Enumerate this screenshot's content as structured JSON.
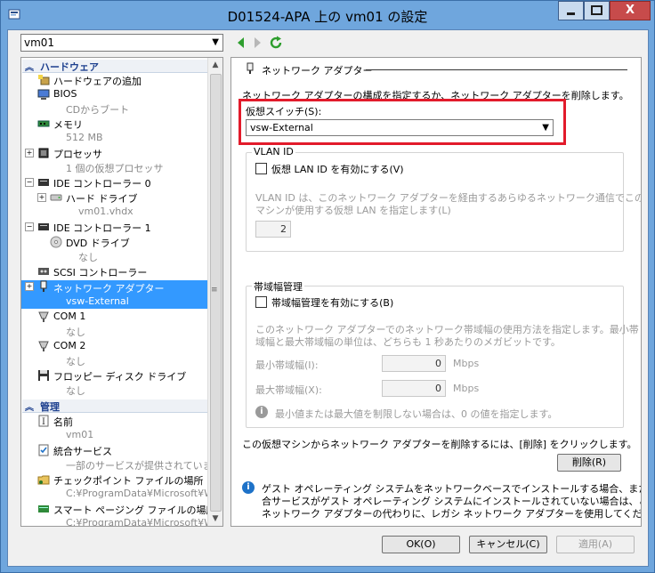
{
  "window": {
    "title": "D01524-APA 上の vm01 の設定",
    "close_glyph": "X"
  },
  "vm_selector": {
    "value": "vm01"
  },
  "tree": {
    "hardware_header": "ハードウェア",
    "management_header": "管理",
    "items": [
      {
        "label": "ハードウェアの追加",
        "sub": ""
      },
      {
        "label": "BIOS",
        "sub": "CDからブート"
      },
      {
        "label": "メモリ",
        "sub": "512 MB"
      },
      {
        "label": "プロセッサ",
        "sub": "1 個の仮想プロセッサ"
      },
      {
        "label": "IDE コントローラー 0",
        "sub": ""
      },
      {
        "label": "ハード ドライブ",
        "sub": "vm01.vhdx"
      },
      {
        "label": "IDE コントローラー 1",
        "sub": ""
      },
      {
        "label": "DVD ドライブ",
        "sub": "なし"
      },
      {
        "label": "SCSI コントローラー",
        "sub": ""
      },
      {
        "label": "ネットワーク アダプター",
        "sub": "vsw-External"
      },
      {
        "label": "COM 1",
        "sub": "なし"
      },
      {
        "label": "COM 2",
        "sub": "なし"
      },
      {
        "label": "フロッピー ディスク ドライブ",
        "sub": "なし"
      }
    ],
    "mgmt_items": [
      {
        "label": "名前",
        "sub": "vm01"
      },
      {
        "label": "統合サービス",
        "sub": "一部のサービスが提供されています"
      },
      {
        "label": "チェックポイント ファイルの場所",
        "sub": "C:¥ProgramData¥Microsoft¥Wi..."
      },
      {
        "label": "スマート ページング ファイルの場所",
        "sub": "C:¥ProgramData¥Microsoft¥Wi..."
      }
    ]
  },
  "detail": {
    "section_title": "ネットワーク アダプター",
    "description": "ネットワーク アダプターの構成を指定するか、ネットワーク アダプターを削除します。",
    "switch_label": "仮想スイッチ(S):",
    "switch_value": "vsw-External",
    "vlan": {
      "title": "VLAN ID",
      "checkbox_label": "仮想 LAN ID を有効にする(V)",
      "desc_line1": "VLAN ID は、このネットワーク アダプターを経由するあらゆるネットワーク通信でこの仮想",
      "desc_line2": "マシンが使用する仮想 LAN を指定します(L)",
      "value": "2"
    },
    "bandwidth": {
      "title": "帯域幅管理",
      "checkbox_label": "帯域幅管理を有効にする(B)",
      "desc_line1": "このネットワーク アダプターでのネットワーク帯域幅の使用方法を指定します。最小帯",
      "desc_line2": "域幅と最大帯域幅の単位は、どちらも 1 秒あたりのメガビットです。",
      "min_label": "最小帯域幅(I):",
      "min_value": "0",
      "max_label": "最大帯域幅(X):",
      "max_value": "0",
      "unit": "Mbps",
      "hint": "最小値または最大値を制限しない場合は、0 の値を指定します。"
    },
    "remove_text": "この仮想マシンからネットワーク アダプターを削除するには、[削除] をクリックします。",
    "remove_button": "削除(R)",
    "info_line1": "ゲスト オペレーティング システムをネットワークベースでインストールする場合、または統",
    "info_line2": "合サービスがゲスト オペレーティング システムにインストールされていない場合は、この",
    "info_line3": "ネットワーク アダプターの代わりに、レガシ ネットワーク アダプターを使用してください。"
  },
  "footer": {
    "ok": "OK(O)",
    "cancel": "キャンセル(C)",
    "apply": "適用(A)"
  },
  "colors": {
    "selection": "#3399ff",
    "highlight_box": "#e21b2b",
    "section_header_text": "#1c3f8e"
  }
}
